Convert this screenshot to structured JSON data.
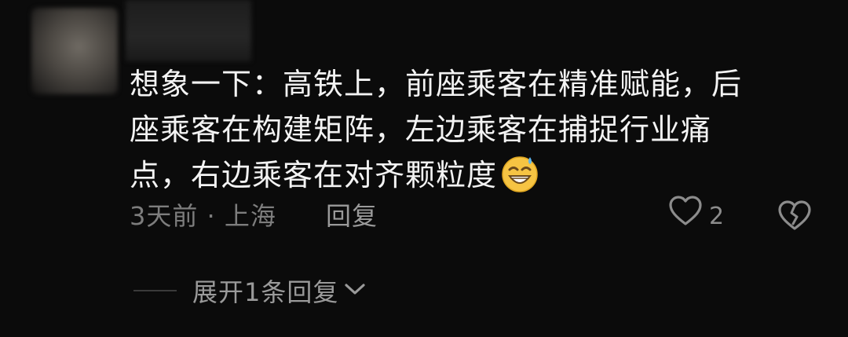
{
  "comment": {
    "lines": [
      "想象一下：高铁上，前座乘客在精准赋能，后",
      "座乘客在构建矩阵，左边乘客在捕捉行业痛",
      "点，右边乘客在对齐颗粒度"
    ],
    "emoji_icon": "grinning-sweat-emoji-icon"
  },
  "meta": {
    "time_location": "3天前 · 上海",
    "reply_label": "回复",
    "like_count": "2",
    "like_icon": "heart-outline-icon",
    "dislike_icon": "broken-heart-icon"
  },
  "replies": {
    "expand_label": "展开1条回复",
    "expand_icon": "chevron-down-icon"
  },
  "colors": {
    "background": "#0b0b0b",
    "text_primary": "#f3f3f3",
    "text_secondary": "#7d7d7d",
    "emoji_yellow": "#f6c443"
  }
}
